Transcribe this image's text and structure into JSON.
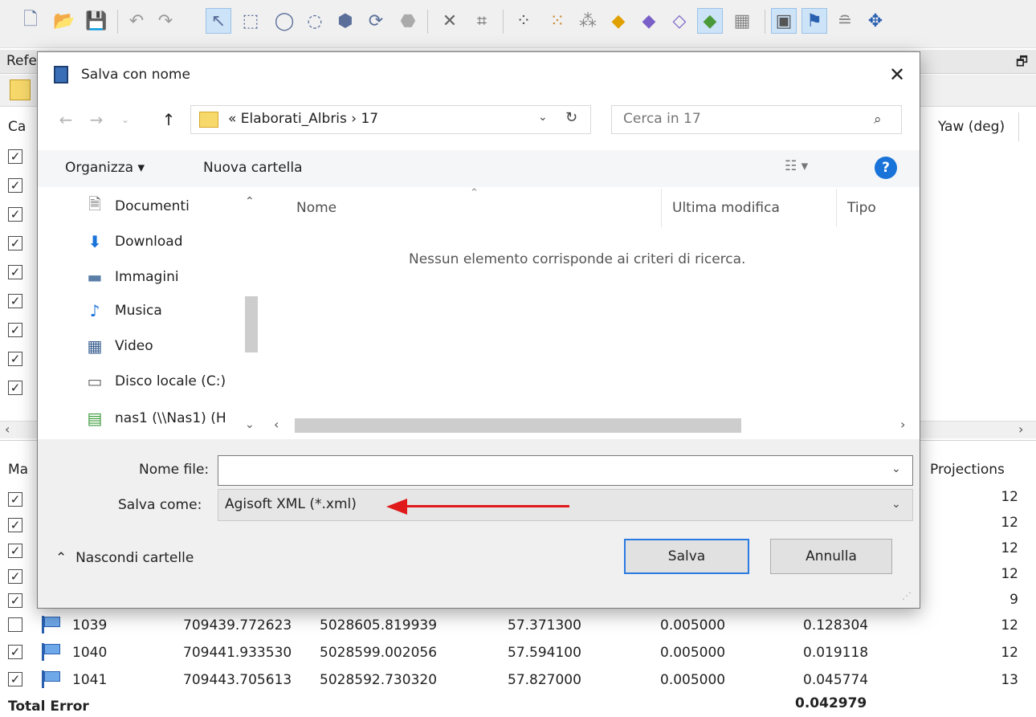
{
  "toolbar": {
    "icons": [
      "new-document-icon",
      "open-folder-icon",
      "save-icon",
      "undo-icon",
      "redo-icon",
      "select-pointer-icon",
      "rectangle-selection-icon",
      "circle-selection-icon",
      "free-selection-icon",
      "move-region-icon",
      "rotate-region-icon",
      "resize-region-icon",
      "remove-icon",
      "crop-icon",
      "point-cloud-icon",
      "dense-cloud-icon",
      "tie-points-icon",
      "model-solid-icon",
      "model-shaded-icon",
      "model-wireframe-icon",
      "model-textured-icon",
      "tiled-model-icon",
      "show-cameras-icon",
      "show-markers-icon",
      "show-shapes-icon",
      "center-view-icon"
    ]
  },
  "reference_panel": {
    "title": "Refe",
    "camera_table": {
      "col_first": "Ca",
      "col_yaw": "Yaw (deg)"
    },
    "marker_table": {
      "col_first": "Ma",
      "col_projections": "Projections"
    },
    "projections_partial": [
      "12",
      "12",
      "12",
      "12",
      "9"
    ],
    "rows": [
      {
        "checked": false,
        "label": "1039",
        "x": "709439.772623",
        "y": "5028605.819939",
        "z": "57.371300",
        "accuracy": "0.005000",
        "error": "0.128304",
        "projections": "12"
      },
      {
        "checked": true,
        "label": "1040",
        "x": "709441.933530",
        "y": "5028599.002056",
        "z": "57.594100",
        "accuracy": "0.005000",
        "error": "0.019118",
        "projections": "12"
      },
      {
        "checked": true,
        "label": "1041",
        "x": "709443.705613",
        "y": "5028592.730320",
        "z": "57.827000",
        "accuracy": "0.005000",
        "error": "0.045774",
        "projections": "13"
      }
    ],
    "total_label": "Total Error",
    "total_value": "0.042979"
  },
  "dialog": {
    "title": "Salva con nome",
    "close_symbol": "✕",
    "address": {
      "path": "«  Elaborati_Albris  ›  17"
    },
    "search_placeholder": "Cerca in 17",
    "commands": {
      "organize": "Organizza ▾",
      "new_folder": "Nuova cartella",
      "view": "☷ ▾",
      "help": "?"
    },
    "nav_items": [
      {
        "label": "Documenti",
        "icon": "documents-icon"
      },
      {
        "label": "Download",
        "icon": "download-icon"
      },
      {
        "label": "Immagini",
        "icon": "pictures-icon"
      },
      {
        "label": "Musica",
        "icon": "music-icon"
      },
      {
        "label": "Video",
        "icon": "video-icon"
      },
      {
        "label": "Disco locale (C:)",
        "icon": "local-disk-icon"
      },
      {
        "label": "nas1 (\\\\Nas1) (H",
        "icon": "network-drive-icon"
      }
    ],
    "columns": {
      "name": "Nome",
      "modified": "Ultima modifica",
      "type": "Tipo"
    },
    "empty_message": "Nessun elemento corrisponde ai criteri di ricerca.",
    "filename_label": "Nome file:",
    "filename_value": "",
    "filetype_label": "Salva come:",
    "filetype_value": "Agisoft XML (*.xml)",
    "hide_folders": "Nascondi cartelle",
    "save_button": "Salva",
    "cancel_button": "Annulla",
    "colors": {
      "accent": "#1a73d8",
      "annotation_arrow": "#e01a1a",
      "focus_border": "#2a7ae2"
    }
  }
}
